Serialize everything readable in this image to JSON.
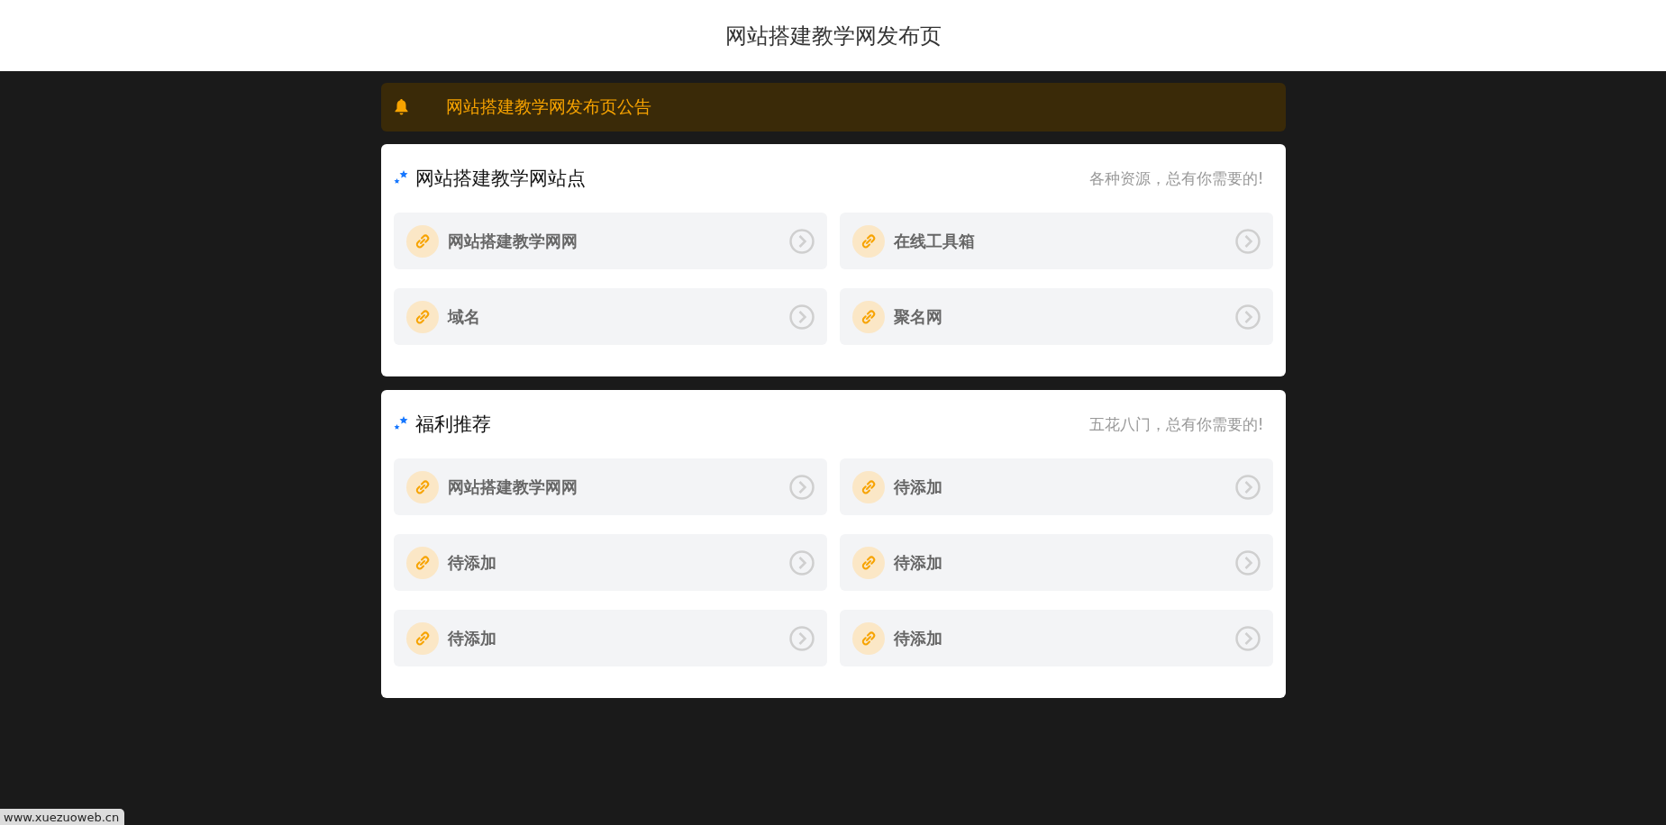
{
  "header": {
    "title": "网站搭建教学网发布页"
  },
  "notice": {
    "text": "网站搭建教学网发布页公告"
  },
  "sections": [
    {
      "title": "网站搭建教学网站点",
      "subtitle": "各种资源，总有你需要的!",
      "links": [
        {
          "label": "网站搭建教学网网"
        },
        {
          "label": "在线工具箱"
        },
        {
          "label": "域名"
        },
        {
          "label": "聚名网"
        }
      ]
    },
    {
      "title": "福利推荐",
      "subtitle": "五花八门，总有你需要的!",
      "links": [
        {
          "label": "网站搭建教学网网"
        },
        {
          "label": "待添加"
        },
        {
          "label": "待添加"
        },
        {
          "label": "待添加"
        },
        {
          "label": "待添加"
        },
        {
          "label": "待添加"
        }
      ]
    }
  ],
  "status_bar": {
    "url": "www.xuezuoweb.cn"
  }
}
